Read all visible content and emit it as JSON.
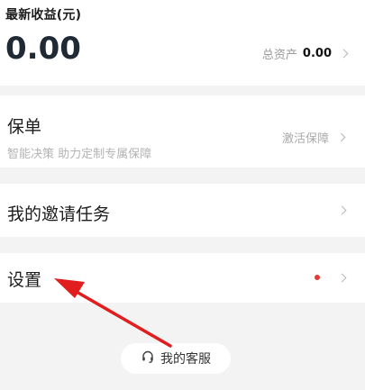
{
  "earnings": {
    "title": "最新收益(元)",
    "amount": "0.00",
    "assets_label": "总资产",
    "assets_value": "0.00"
  },
  "policy": {
    "title": "保单",
    "subtitle": "智能决策 助力定制专属保障",
    "action": "激活保障"
  },
  "invite": {
    "title": "我的邀请任务"
  },
  "settings": {
    "title": "设置"
  },
  "service": {
    "label": "我的客服",
    "icon": "headset-icon"
  },
  "colors": {
    "background": "#f3f3f3",
    "card": "#ffffff",
    "amount": "#202a35",
    "muted": "#9a9a9a",
    "red_dot": "#e33b35",
    "arrow": "#e11d1d"
  }
}
